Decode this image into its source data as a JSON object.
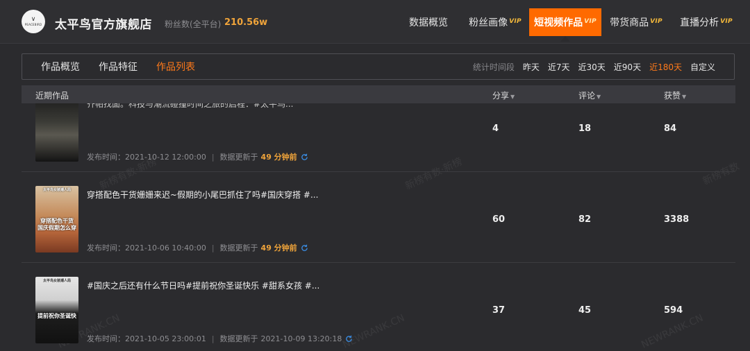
{
  "header": {
    "logo_mark": "∨",
    "logo_text": "PEACEBIRD",
    "shop_name": "太平鸟官方旗舰店",
    "fans_label": "粉丝数(全平台)",
    "fans_value": "210.56w",
    "nav": [
      {
        "label": "数据概览",
        "vip": ""
      },
      {
        "label": "粉丝画像",
        "vip": "VIP"
      },
      {
        "label": "短视频作品",
        "vip": "VIP",
        "active": true
      },
      {
        "label": "带货商品",
        "vip": "VIP"
      },
      {
        "label": "直播分析",
        "vip": "VIP"
      }
    ]
  },
  "subtabs": [
    "作品概览",
    "作品特征",
    "作品列表"
  ],
  "period": {
    "label": "统计时间段",
    "options": [
      "昨天",
      "近7天",
      "近30天",
      "近90天",
      "近180天",
      "自定义"
    ],
    "active": "近180天"
  },
  "table": {
    "headers": {
      "works": "近期作品",
      "share": "分享",
      "comment": "评论",
      "like": "获赞"
    },
    "publish_label": "发布时间：",
    "update_label": "数据更新于",
    "rows": [
      {
        "title": "齐帕找面。科技与潮流碰撞时间之旅的启程：#太平鸟...",
        "publish_time": "2021-10-12 12:00:00",
        "update": "49 分钟前",
        "share": "4",
        "comment": "18",
        "like": "84"
      },
      {
        "title": "穿搭配色干货姗姗来迟~假期的小尾巴抓住了吗#国庆穿搭 #...",
        "thumb_caption": "穿搭配色干货 国庆假期怎么穿",
        "thumb_top": "太平鸟女装潮人局",
        "publish_time": "2021-10-06 10:40:00",
        "update": "49 分钟前",
        "share": "60",
        "comment": "82",
        "like": "3388"
      },
      {
        "title": "#国庆之后还有什么节日吗#提前祝你圣诞快乐 #甜系女孩 #...",
        "thumb_caption": "提前祝你圣诞快",
        "thumb_top": "太平鸟女装潮人局",
        "publish_time": "2021-10-05 23:00:01",
        "update": "2021-10-09 13:20:18",
        "share": "37",
        "comment": "45",
        "like": "594"
      }
    ]
  },
  "watermarks": [
    "新榜有数·新榜",
    "新榜有数·新榜",
    "新榜有数",
    "NEWRANK.CN",
    "NEWRANK.CN",
    "NEWRANK.CN"
  ],
  "colors": {
    "accent": "#ff6a00",
    "highlight": "#f0a43a",
    "vip": "#f3b83b",
    "refresh": "#3a8ee6"
  }
}
